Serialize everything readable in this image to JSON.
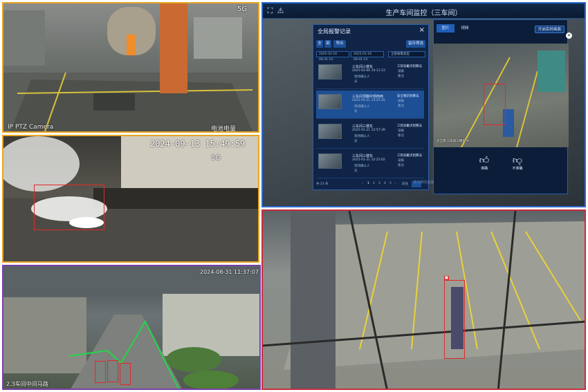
{
  "panel_top_left": {
    "osd_label": "IP PTZ Camera",
    "osd_sublabel": "电池电量",
    "signal": "5G"
  },
  "panel_mid_left": {
    "timestamp": "2024-09-13 15:49:59",
    "signal": "5G"
  },
  "panel_bottom_left": {
    "timestamp": "2024-08-31 11:37:07",
    "location_label": "2.3车间中间马路"
  },
  "monitor": {
    "title": "生产车间监控（三车间）",
    "dialog": {
      "title": "全局报警记录",
      "btn_all": "全",
      "btn_partial": "部",
      "btn_export": "导出",
      "btn_filter": "留存筛选",
      "date_start": "2025-01-16 09:41:14",
      "date_end": "2025-01-16 09:41:14",
      "type_select": "全部报警类型",
      "records": [
        {
          "name": "三车间三楼东",
          "time": "2025-02-06 10:11:13",
          "status": "现场确认人",
          "status2": "员",
          "type": "工装穿戴识别算法",
          "flag": "误报",
          "note": "备注"
        },
        {
          "name": "三车间顶棚中部西西",
          "time": "2025-01-21 14:25:25",
          "status": "现场确认人",
          "status2": "员",
          "type": "安全帽识别算法",
          "flag": "误报",
          "note": "备注"
        },
        {
          "name": "三车间三楼东",
          "time": "2025-01-21 12:57:39",
          "status": "现场确认人",
          "status2": "员",
          "type": "工装穿戴识别算法",
          "flag": "误报",
          "note": "备注"
        },
        {
          "name": "三车间三楼东",
          "time": "2025-01-21 12:25:02",
          "status": "现场确认人",
          "status2": "员",
          "type": "工装穿戴识别算法",
          "flag": "误报",
          "note": "备注"
        }
      ],
      "pager_total": "共 23 条",
      "pages": [
        "1",
        "2",
        "3",
        "4",
        "5"
      ],
      "pager_next": "前往"
    },
    "detail": {
      "tab_image": "图片",
      "tab_video": "视频",
      "live_button": "开启实时画面",
      "image_caption": "大卫李 三车间三楼东 H",
      "confirm_label": "准确",
      "reject_label": "不准确",
      "footer": "暂无相关画面"
    }
  }
}
